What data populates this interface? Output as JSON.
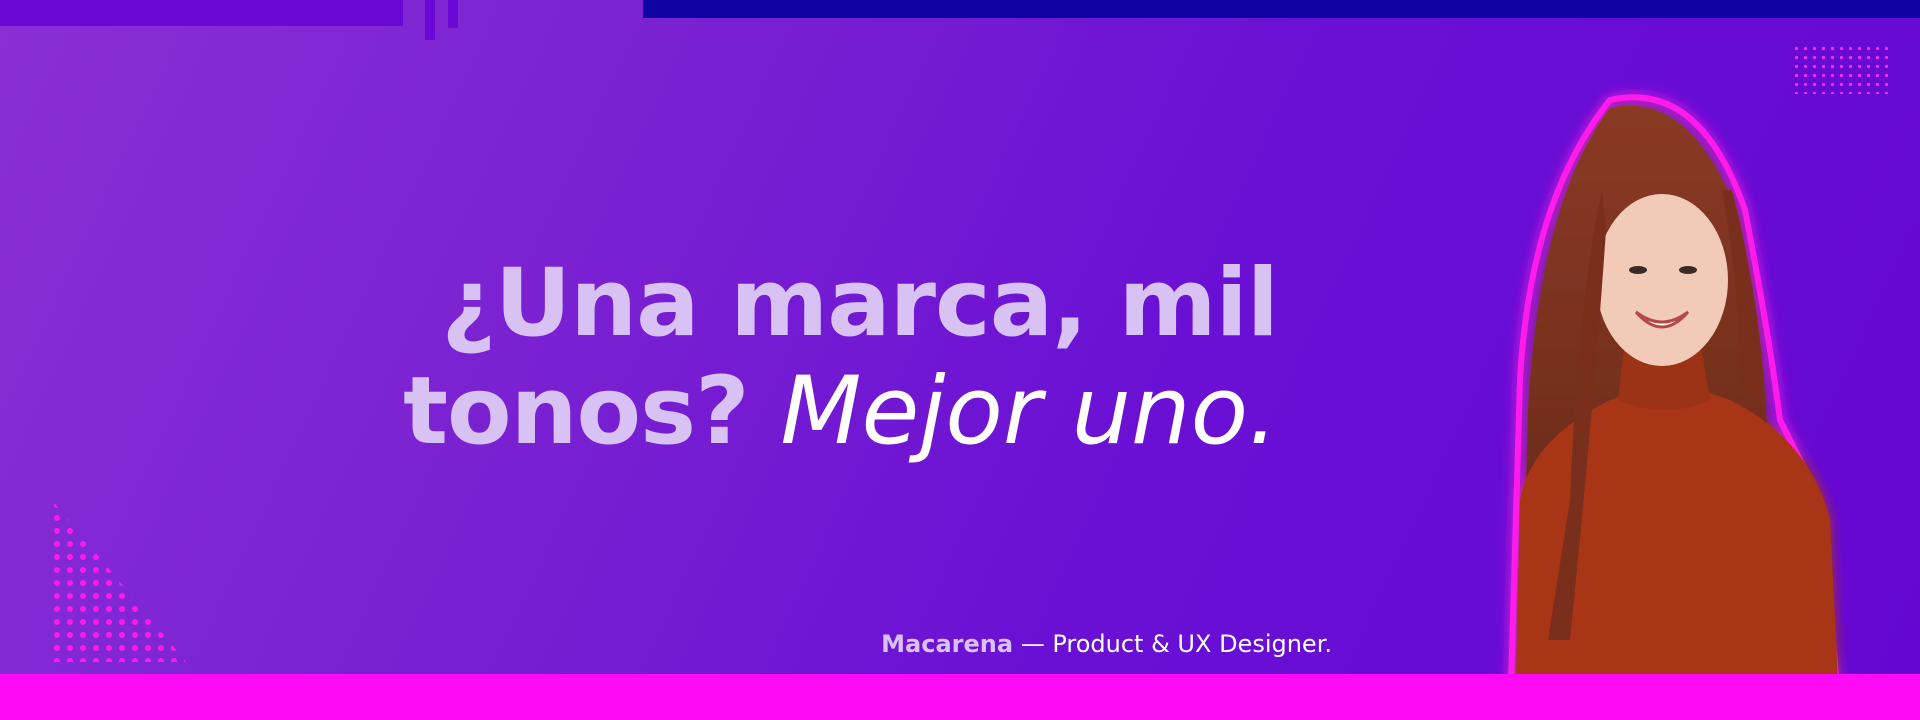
{
  "headline": {
    "line1": "¿Una marca, mil",
    "line2_bold": "tonos?",
    "line2_light": "Mejor uno."
  },
  "tagline": {
    "name": "Macarena",
    "role": " — Product & UX Designer."
  },
  "colors": {
    "background_start": "#8a2fd6",
    "background_end": "#6506d2",
    "accent_pink": "#ff0af4",
    "top_bar_blue": "#0e02a2",
    "headline_lavender": "#d8c2f4",
    "headline_white": "#ffffff"
  },
  "icons": [
    "dot-grid-pattern",
    "dot-triangle-pattern",
    "portrait-photo"
  ]
}
